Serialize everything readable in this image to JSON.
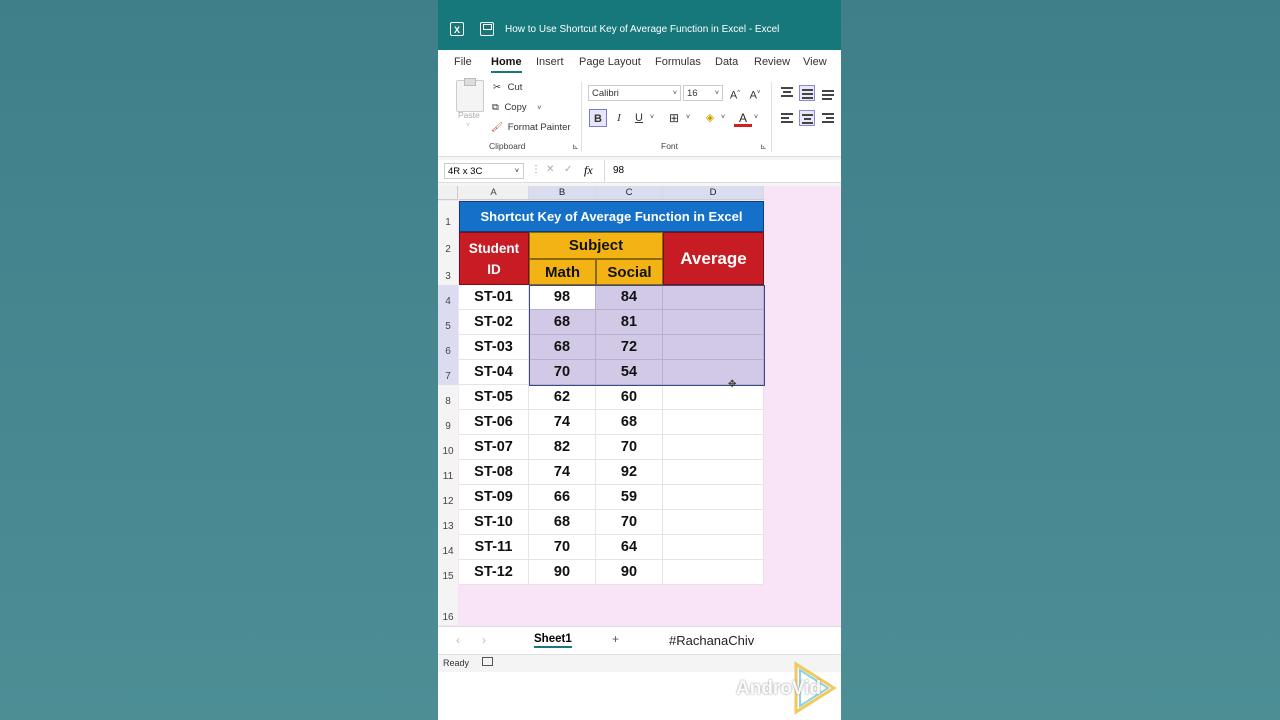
{
  "window": {
    "title": "How to Use Shortcut Key of Average Function in Excel  -  Excel"
  },
  "tabs": [
    "File",
    "Home",
    "Insert",
    "Page Layout",
    "Formulas",
    "Data",
    "Review",
    "View"
  ],
  "ribbon": {
    "paste": "Paste",
    "cut": "Cut",
    "copy": "Copy",
    "format_painter": "Format Painter",
    "clipboard_label": "Clipboard",
    "font_name": "Calibri",
    "font_size": "16",
    "bold": "B",
    "italic": "I",
    "underline": "U",
    "font_label": "Font",
    "grow_font": "A^",
    "shrink_font": "A˅"
  },
  "formula_bar": {
    "name_box": "4R x 3C",
    "fx": "fx",
    "value": "98"
  },
  "columns": [
    "A",
    "B",
    "C",
    "D"
  ],
  "rows": [
    "1",
    "2",
    "3",
    "4",
    "5",
    "6",
    "7",
    "8",
    "9",
    "10",
    "11",
    "12",
    "13",
    "14",
    "15",
    "16"
  ],
  "sheet": {
    "title": "Shortcut Key of Average Function in Excel",
    "student_id_header": "Student ID",
    "subject_header": "Subject",
    "math_header": "Math",
    "social_header": "Social",
    "average_header": "Average",
    "data": [
      [
        "ST-01",
        "98",
        "84"
      ],
      [
        "ST-02",
        "68",
        "81"
      ],
      [
        "ST-03",
        "68",
        "72"
      ],
      [
        "ST-04",
        "70",
        "54"
      ],
      [
        "ST-05",
        "62",
        "60"
      ],
      [
        "ST-06",
        "74",
        "68"
      ],
      [
        "ST-07",
        "82",
        "70"
      ],
      [
        "ST-08",
        "74",
        "92"
      ],
      [
        "ST-09",
        "66",
        "59"
      ],
      [
        "ST-10",
        "68",
        "70"
      ],
      [
        "ST-11",
        "70",
        "64"
      ],
      [
        "ST-12",
        "90",
        "90"
      ]
    ]
  },
  "sheet_tabs": {
    "active": "Sheet1",
    "add": "+",
    "watermark_tag": "#RachanaChiv"
  },
  "status": {
    "ready": "Ready"
  },
  "brand_watermark": "AndroVid",
  "colors": {
    "titlebar": "#16787b",
    "title_cell": "#1470c8",
    "header_red": "#c81c24",
    "header_yellow": "#f3b314",
    "selection": "#d2c9e6"
  }
}
